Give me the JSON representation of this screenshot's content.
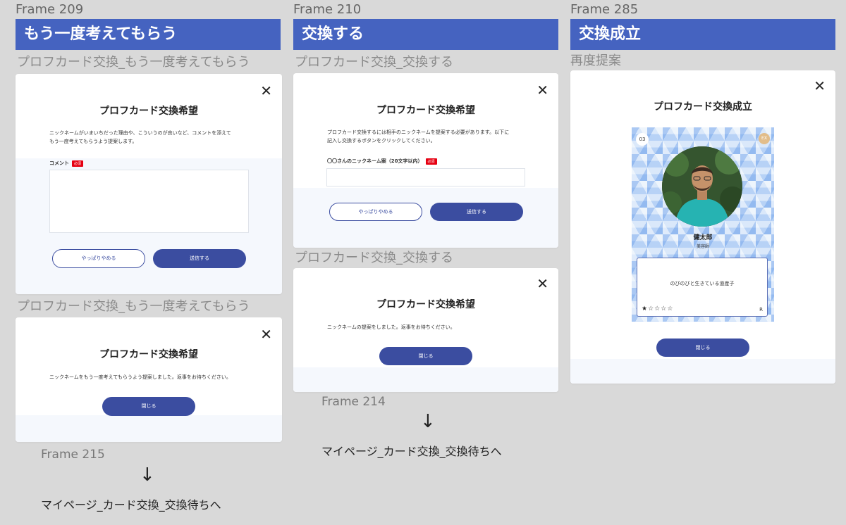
{
  "columns": [
    {
      "frame_label": "Frame 209",
      "banner": "もう一度考えてもらう",
      "modals": [
        {
          "sub_label": "プロフカード交換_もう一度考えてもらう",
          "title": "プロフカード交換希望",
          "body": "ニックネームがいまいちだった理由や、こういうのが良いなど、コメントを添えて\nもう一度考えてもらうよう提案します。",
          "field_label": "コメント",
          "required": "必須",
          "cancel": "やっぱりやめる",
          "submit": "送信する"
        },
        {
          "sub_label": "プロフカード交換_もう一度考えてもらう",
          "title": "プロフカード交換希望",
          "body": "ニックネームをもう一度考えてもらうよう提案しました。返事をお待ちください。",
          "close": "閉じる"
        }
      ],
      "next_frame": "Frame 215",
      "arrow": "↓",
      "next_page": "マイページ_カード交換_交換待ちへ"
    },
    {
      "frame_label": "Frame 210",
      "banner": "交換する",
      "modals": [
        {
          "sub_label": "プロフカード交換_交換する",
          "title": "プロフカード交換希望",
          "body": "プロフカード交換するには相手のニックネームを提案する必要があります。以下に\n記入し交換するボタンをクリックしてください。",
          "field_label": "〇〇さんのニックネーム案（20文字以内）",
          "required": "必須",
          "cancel": "やっぱりやめる",
          "submit": "送信する"
        },
        {
          "sub_label": "プロフカード交換_交換する",
          "title": "プロフカード交換希望",
          "body": "ニックネームの提案をしました。返事をお待ちください。",
          "close": "閉じる"
        }
      ],
      "next_frame": "Frame 214",
      "arrow": "↓",
      "next_page": "マイページ_カード交換_交換待ちへ"
    },
    {
      "frame_label": "Frame 285",
      "banner": "交換成立",
      "modals": [
        {
          "sub_label": "再度提案",
          "title": "プロフカード交換成立",
          "card": {
            "number": "03",
            "badge": "EX",
            "name": "健太郎",
            "role": "美容師",
            "catchphrase": "のびのびと生きている道産子",
            "stars_filled": 1,
            "stars_total": 5,
            "rarity": "R"
          },
          "close": "閉じる"
        }
      ]
    }
  ],
  "icons": {
    "close": "close-icon",
    "filled_star": "★",
    "empty_star": "☆"
  },
  "colors": {
    "banner": "#4563c0",
    "button": "#3b4da0",
    "required": "#e60012",
    "background": "#d9d9d9"
  }
}
